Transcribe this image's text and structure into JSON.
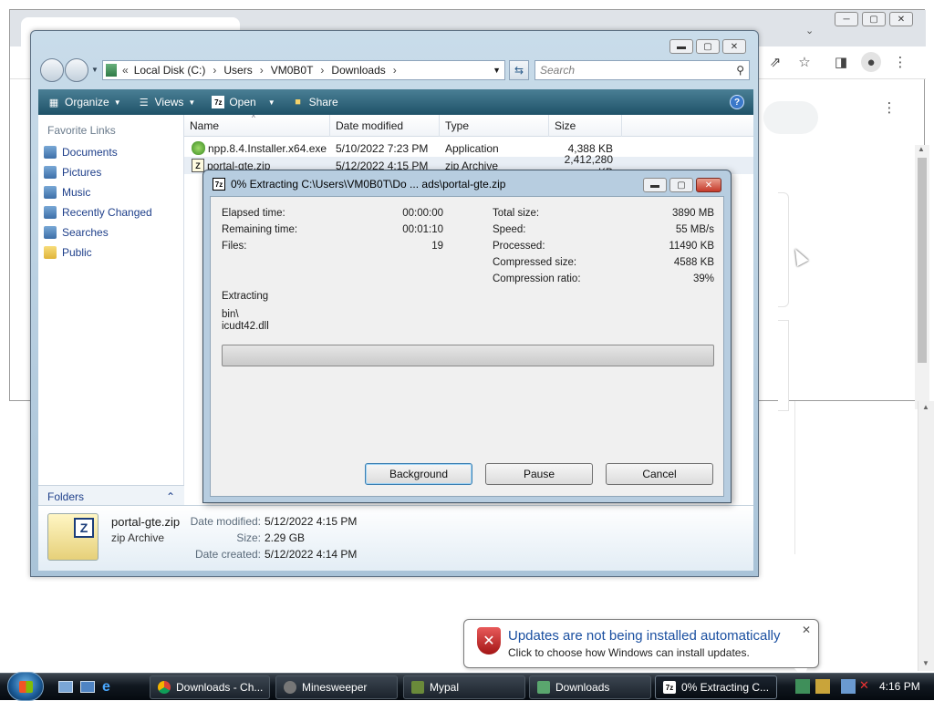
{
  "chrome": {
    "window_controls": [
      "─",
      "▢",
      "✕"
    ],
    "icons": [
      "share-icon",
      "star-icon",
      "sidebar-icon",
      "profile-icon",
      "menu-icon"
    ]
  },
  "explorer": {
    "breadcrumb": [
      "Local Disk (C:)",
      "Users",
      "VM0B0T",
      "Downloads"
    ],
    "search_placeholder": "Search",
    "toolbar": {
      "organize": "Organize",
      "views": "Views",
      "open": "Open",
      "share": "Share"
    },
    "favorites_title": "Favorite Links",
    "favorites": [
      "Documents",
      "Pictures",
      "Music",
      "Recently Changed",
      "Searches",
      "Public"
    ],
    "folders_label": "Folders",
    "columns": [
      "Name",
      "Date modified",
      "Type",
      "Size"
    ],
    "files": [
      {
        "name": "npp.8.4.Installer.x64.exe",
        "date": "5/10/2022 7:23 PM",
        "type": "Application",
        "size": "4,388 KB"
      },
      {
        "name": "portal-gte.zip",
        "date": "5/12/2022 4:15 PM",
        "type": "zip Archive",
        "size": "2,412,280 KB"
      }
    ],
    "details": {
      "filename": "portal-gte.zip",
      "type": "zip Archive",
      "date_modified_label": "Date modified:",
      "date_modified": "5/12/2022 4:15 PM",
      "size_label": "Size:",
      "size": "2.29 GB",
      "date_created_label": "Date created:",
      "date_created": "5/12/2022 4:14 PM"
    }
  },
  "dialog": {
    "title": "0% Extracting C:\\Users\\VM0B0T\\Do ... ads\\portal-gte.zip",
    "elapsed_label": "Elapsed time:",
    "elapsed": "00:00:00",
    "remaining_label": "Remaining time:",
    "remaining": "00:01:10",
    "files_label": "Files:",
    "files": "19",
    "total_size_label": "Total size:",
    "total_size": "3890 MB",
    "speed_label": "Speed:",
    "speed": "55 MB/s",
    "processed_label": "Processed:",
    "processed": "11490 KB",
    "compressed_label": "Compressed size:",
    "compressed": "4588 KB",
    "ratio_label": "Compression ratio:",
    "ratio": "39%",
    "extracting_label": "Extracting",
    "path_line1": "bin\\",
    "path_line2": "icudt42.dll",
    "progress": 0,
    "buttons": {
      "background": "Background",
      "pause": "Pause",
      "cancel": "Cancel"
    }
  },
  "notification": {
    "title": "Updates are not being installed automatically",
    "body": "Click to choose how Windows can install updates."
  },
  "taskbar": {
    "tasks": [
      "Downloads - Ch...",
      "Minesweeper",
      "Mypal",
      "Downloads",
      "0% Extracting C..."
    ],
    "clock": "4:16 PM"
  }
}
